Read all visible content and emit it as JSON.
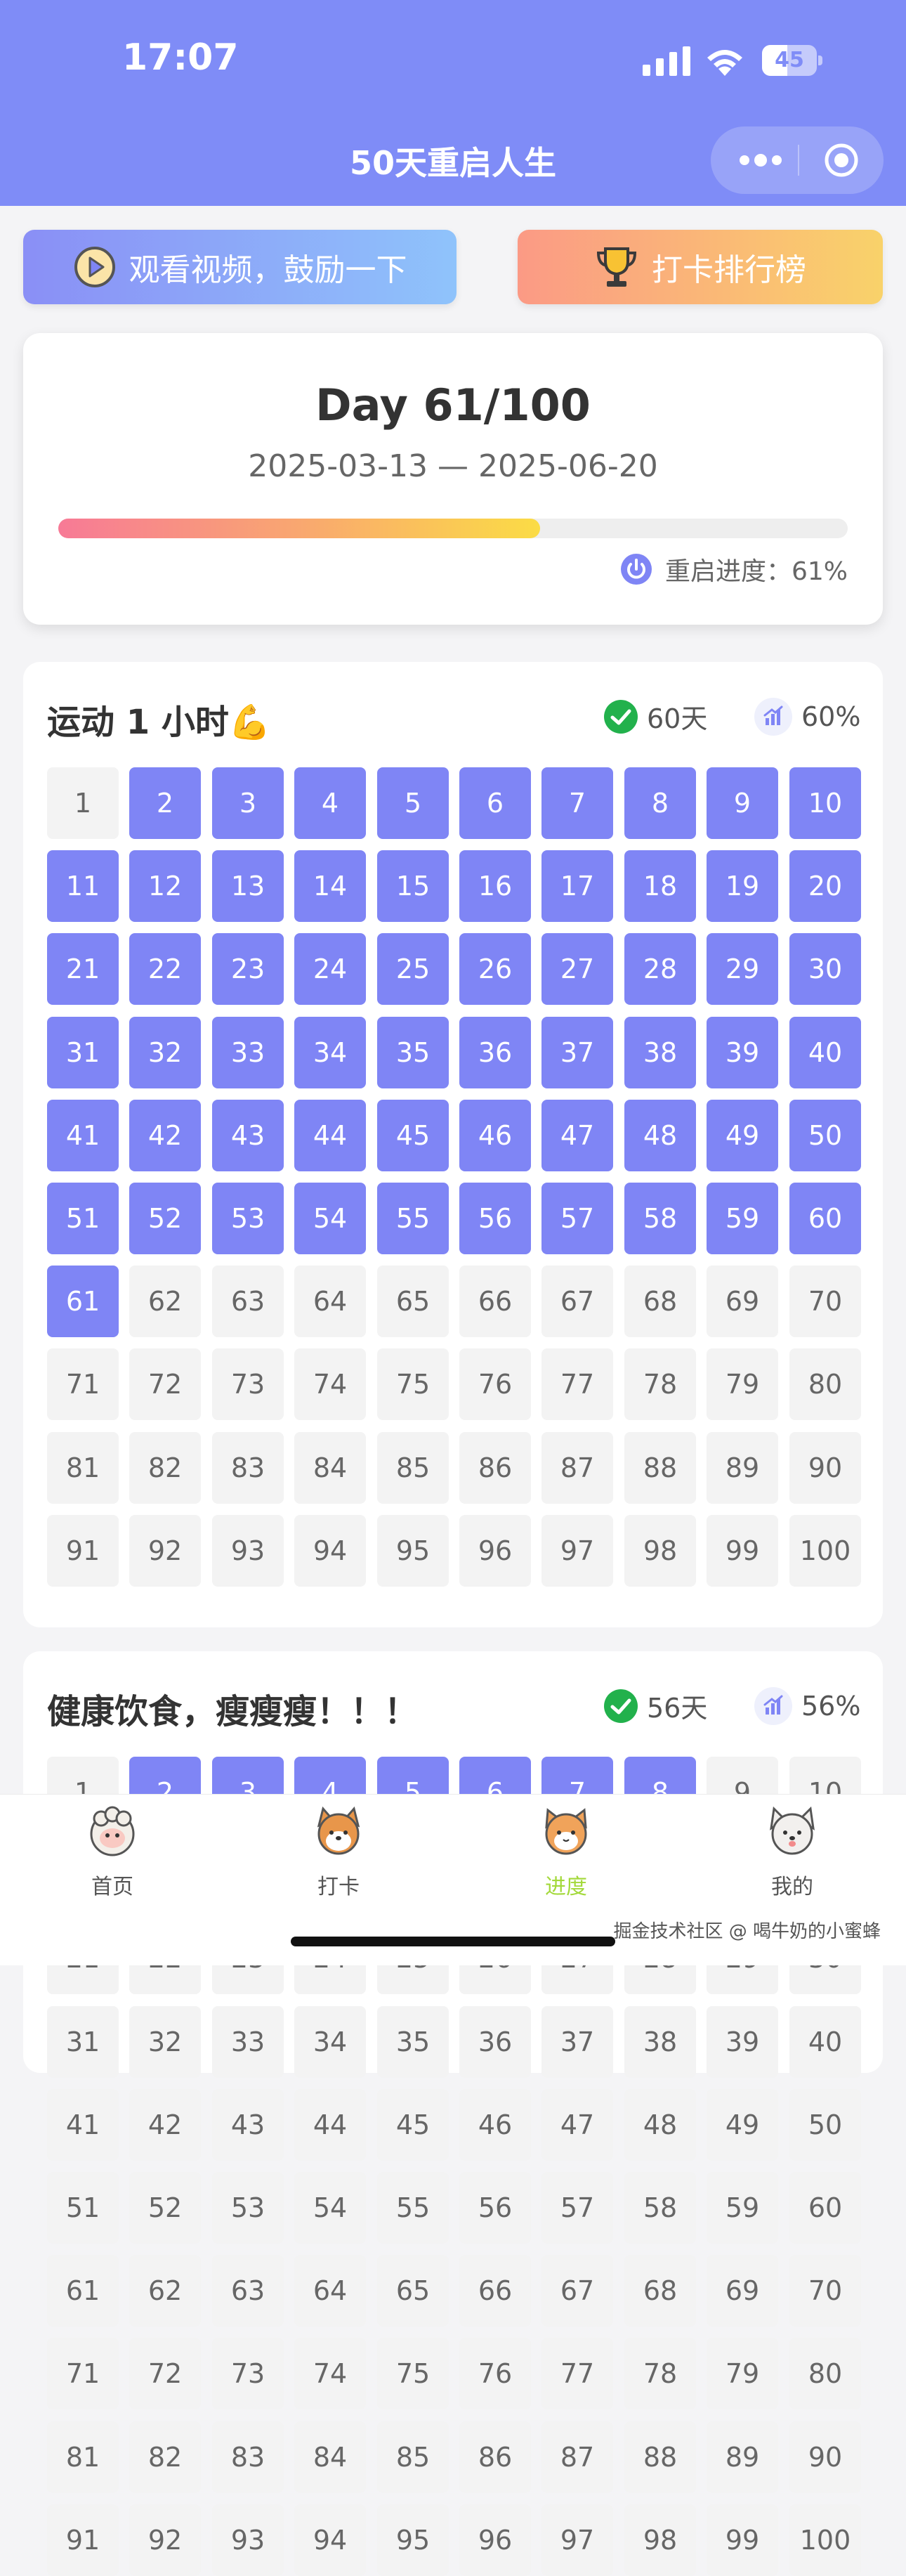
{
  "status_bar": {
    "time": "17:07",
    "battery": "45"
  },
  "header": {
    "title": "50天重启人生"
  },
  "actions": {
    "video_label": "观看视频，鼓励一下",
    "rank_label": "打卡排行榜"
  },
  "summary": {
    "day": "Day 61/100",
    "date_range": "2025-03-13 — 2025-06-20",
    "progress_fraction": 0.61,
    "progress_label": "重启进度：61%"
  },
  "habits": [
    {
      "title": "运动 1 小时💪",
      "days_label": "60天",
      "percent_label": "60%",
      "completed": [
        2,
        3,
        4,
        5,
        6,
        7,
        8,
        9,
        10,
        11,
        12,
        13,
        14,
        15,
        16,
        17,
        18,
        19,
        20,
        21,
        22,
        23,
        24,
        25,
        26,
        27,
        28,
        29,
        30,
        31,
        32,
        33,
        34,
        35,
        36,
        37,
        38,
        39,
        40,
        41,
        42,
        43,
        44,
        45,
        46,
        47,
        48,
        49,
        50,
        51,
        52,
        53,
        54,
        55,
        56,
        57,
        58,
        59,
        60,
        61
      ],
      "total": 100
    },
    {
      "title": "健康饮食，瘦瘦瘦！！！",
      "days_label": "56天",
      "percent_label": "56%",
      "completed": [
        2,
        3,
        4,
        5,
        6,
        7,
        8
      ],
      "total": 100
    }
  ],
  "tabs": [
    {
      "label": "首页",
      "icon": "sheep-icon",
      "active": false
    },
    {
      "label": "打卡",
      "icon": "shiba-icon",
      "active": false
    },
    {
      "label": "进度",
      "icon": "cat-icon",
      "active": true
    },
    {
      "label": "我的",
      "icon": "dog-icon",
      "active": false
    }
  ],
  "watermark": "掘金技术社区 @ 喝牛奶的小蜜蜂",
  "colors": {
    "primary": "#7f85f5",
    "header": "#7f8cf7",
    "active_tab": "#a3d93a",
    "check": "#22b14c"
  }
}
